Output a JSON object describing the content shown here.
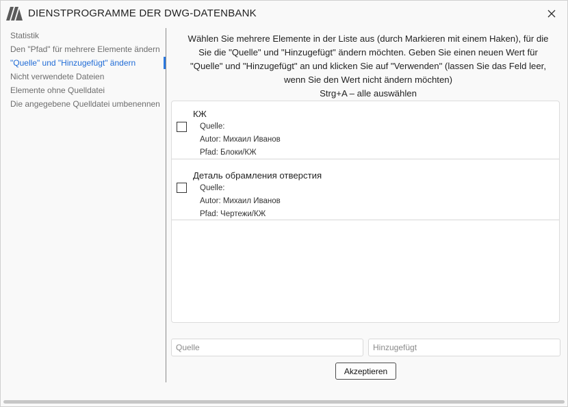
{
  "window": {
    "title": "DIENSTPROGRAMME DER DWG-DATENBANK"
  },
  "icons": {
    "logo": "app-logo-m-icon",
    "close": "close-icon"
  },
  "colors": {
    "accent": "#1f6bd6",
    "sidebar_text": "#6d6d6d"
  },
  "sidebar": {
    "items": [
      {
        "label": "Statistik",
        "active": false
      },
      {
        "label": "Den \"Pfad\" für mehrere Elemente ändern",
        "active": false
      },
      {
        "label": "\"Quelle\" und \"Hinzugefügt\" ändern",
        "active": true
      },
      {
        "label": "Nicht verwendete Dateien",
        "active": false
      },
      {
        "label": "Elemente ohne Quelldatei",
        "active": false
      },
      {
        "label": "Die angegebene Quelldatei umbenennen",
        "active": false
      }
    ]
  },
  "main": {
    "instructions": [
      "Wählen Sie mehrere Elemente in der Liste aus (durch Markieren mit einem Haken), für die",
      "Sie die \"Quelle\" und \"Hinzugefügt\" ändern möchten. Geben Sie einen neuen Wert für",
      "\"Quelle\" und \"Hinzugefügt\" an und klicken Sie auf \"Verwenden\" (lassen Sie das Feld leer,",
      "wenn Sie den Wert nicht ändern möchten)",
      "Strg+A – alle auswählen"
    ],
    "items": [
      {
        "name": "КЖ",
        "source": "Quelle:",
        "author": "Autor: Михаил Иванов",
        "path": "Pfad: Блоки/КЖ",
        "checked": false
      },
      {
        "name": "Деталь обрамления отверстия",
        "source": "Quelle:",
        "author": "Autor: Михаил Иванов",
        "path": "Pfad: Чертежи/КЖ",
        "checked": false
      }
    ],
    "source_input": {
      "value": "",
      "placeholder": "Quelle"
    },
    "added_input": {
      "value": "",
      "placeholder": "Hinzugefügt"
    },
    "accept_label": "Akzeptieren"
  }
}
